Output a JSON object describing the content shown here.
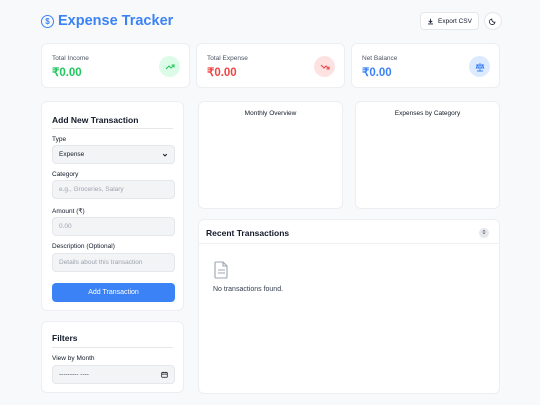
{
  "app": {
    "title": "Expense Tracker",
    "logo_icon": "dollar-circle-icon",
    "accent": "#3b82f6"
  },
  "header": {
    "export_label": "Export CSV",
    "export_icon": "download-icon",
    "theme_icon": "moon-icon"
  },
  "stats": [
    {
      "label": "Total Income",
      "value": "₹0.00",
      "color": "#22c55e",
      "icon": "trending-up-icon"
    },
    {
      "label": "Total Expense",
      "value": "₹0.00",
      "color": "#ef4444",
      "icon": "trending-down-icon"
    },
    {
      "label": "Net Balance",
      "value": "₹0.00",
      "color": "#3b82f6",
      "icon": "scale-icon"
    }
  ],
  "form": {
    "title": "Add New Transaction",
    "type_label": "Type",
    "type_value": "Expense",
    "category_label": "Category",
    "category_placeholder": "e.g., Groceries, Salary",
    "amount_label": "Amount (₹)",
    "amount_placeholder": "0.00",
    "description_label": "Description (Optional)",
    "description_placeholder": "Details about this transaction",
    "submit_label": "Add Transaction"
  },
  "filters": {
    "title": "Filters",
    "month_label": "View by Month",
    "month_value": "--------- ----"
  },
  "charts": {
    "monthly_title": "Monthly Overview",
    "category_title": "Expenses by Category"
  },
  "transactions": {
    "title": "Recent Transactions",
    "count": "0",
    "empty_text": "No transactions found."
  }
}
